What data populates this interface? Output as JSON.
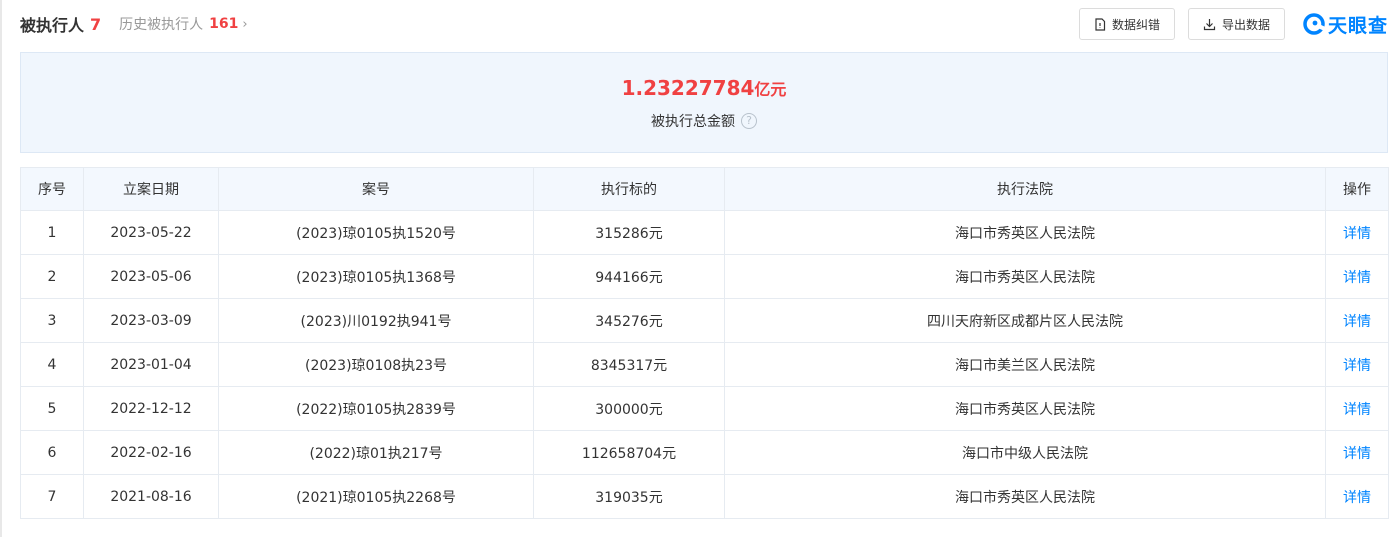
{
  "header": {
    "title": "被执行人",
    "count": "7",
    "history_label": "历史被执行人",
    "history_count": "161",
    "history_chevron": "›",
    "correct_button": "数据纠错",
    "export_button": "导出数据",
    "logo_text": "天眼查",
    "correct_icon": "document-icon",
    "export_icon": "download-icon"
  },
  "summary": {
    "amount": "1.23227784",
    "unit": "亿元",
    "label": "被执行总金额",
    "help": "?"
  },
  "colors": {
    "accent": "#0084ff",
    "highlight": "#f04142"
  },
  "table": {
    "headers": [
      "序号",
      "立案日期",
      "案号",
      "执行标的",
      "执行法院",
      "操作"
    ],
    "rows": [
      {
        "no": "1",
        "date": "2023-05-22",
        "case": "(2023)琼0105执1520号",
        "amount": "315286元",
        "court": "海口市秀英区人民法院",
        "action": "详情"
      },
      {
        "no": "2",
        "date": "2023-05-06",
        "case": "(2023)琼0105执1368号",
        "amount": "944166元",
        "court": "海口市秀英区人民法院",
        "action": "详情"
      },
      {
        "no": "3",
        "date": "2023-03-09",
        "case": "(2023)川0192执941号",
        "amount": "345276元",
        "court": "四川天府新区成都片区人民法院",
        "action": "详情"
      },
      {
        "no": "4",
        "date": "2023-01-04",
        "case": "(2023)琼0108执23号",
        "amount": "8345317元",
        "court": "海口市美兰区人民法院",
        "action": "详情"
      },
      {
        "no": "5",
        "date": "2022-12-12",
        "case": "(2022)琼0105执2839号",
        "amount": "300000元",
        "court": "海口市秀英区人民法院",
        "action": "详情"
      },
      {
        "no": "6",
        "date": "2022-02-16",
        "case": "(2022)琼01执217号",
        "amount": "112658704元",
        "court": "海口市中级人民法院",
        "action": "详情"
      },
      {
        "no": "7",
        "date": "2021-08-16",
        "case": "(2021)琼0105执2268号",
        "amount": "319035元",
        "court": "海口市秀英区人民法院",
        "action": "详情"
      }
    ]
  }
}
